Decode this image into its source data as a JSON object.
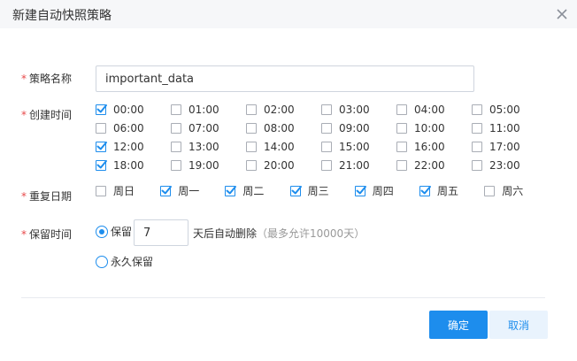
{
  "dialog": {
    "title": "新建自动快照策略",
    "close_icon": "close-icon"
  },
  "form": {
    "policy_name": {
      "label": "策略名称",
      "value": "important_data"
    },
    "create_time": {
      "label": "创建时间",
      "options": [
        {
          "label": "00:00",
          "checked": true
        },
        {
          "label": "01:00",
          "checked": false
        },
        {
          "label": "02:00",
          "checked": false
        },
        {
          "label": "03:00",
          "checked": false
        },
        {
          "label": "04:00",
          "checked": false
        },
        {
          "label": "05:00",
          "checked": false
        },
        {
          "label": "06:00",
          "checked": false
        },
        {
          "label": "07:00",
          "checked": false
        },
        {
          "label": "08:00",
          "checked": false
        },
        {
          "label": "09:00",
          "checked": false
        },
        {
          "label": "10:00",
          "checked": false
        },
        {
          "label": "11:00",
          "checked": false
        },
        {
          "label": "12:00",
          "checked": true
        },
        {
          "label": "13:00",
          "checked": false
        },
        {
          "label": "14:00",
          "checked": false
        },
        {
          "label": "15:00",
          "checked": false
        },
        {
          "label": "16:00",
          "checked": false
        },
        {
          "label": "17:00",
          "checked": false
        },
        {
          "label": "18:00",
          "checked": true
        },
        {
          "label": "19:00",
          "checked": false
        },
        {
          "label": "20:00",
          "checked": false
        },
        {
          "label": "21:00",
          "checked": false
        },
        {
          "label": "22:00",
          "checked": false
        },
        {
          "label": "23:00",
          "checked": false
        }
      ]
    },
    "repeat_days": {
      "label": "重复日期",
      "options": [
        {
          "label": "周日",
          "checked": false
        },
        {
          "label": "周一",
          "checked": true
        },
        {
          "label": "周二",
          "checked": true
        },
        {
          "label": "周三",
          "checked": true
        },
        {
          "label": "周四",
          "checked": true
        },
        {
          "label": "周五",
          "checked": true
        },
        {
          "label": "周六",
          "checked": false
        }
      ]
    },
    "retention": {
      "label": "保留时间",
      "keep_label": "保留",
      "keep_selected": true,
      "days_value": "7",
      "suffix": "天后自动删除",
      "hint": "（最多允许10000天）",
      "forever_label": "永久保留",
      "forever_selected": false
    }
  },
  "footer": {
    "confirm_label": "确定",
    "cancel_label": "取消"
  },
  "colors": {
    "accent": "#1d8ded",
    "required": "#e8494a",
    "title_bar": "#f6f7f9",
    "cancel_bg": "#e9f3fd"
  }
}
